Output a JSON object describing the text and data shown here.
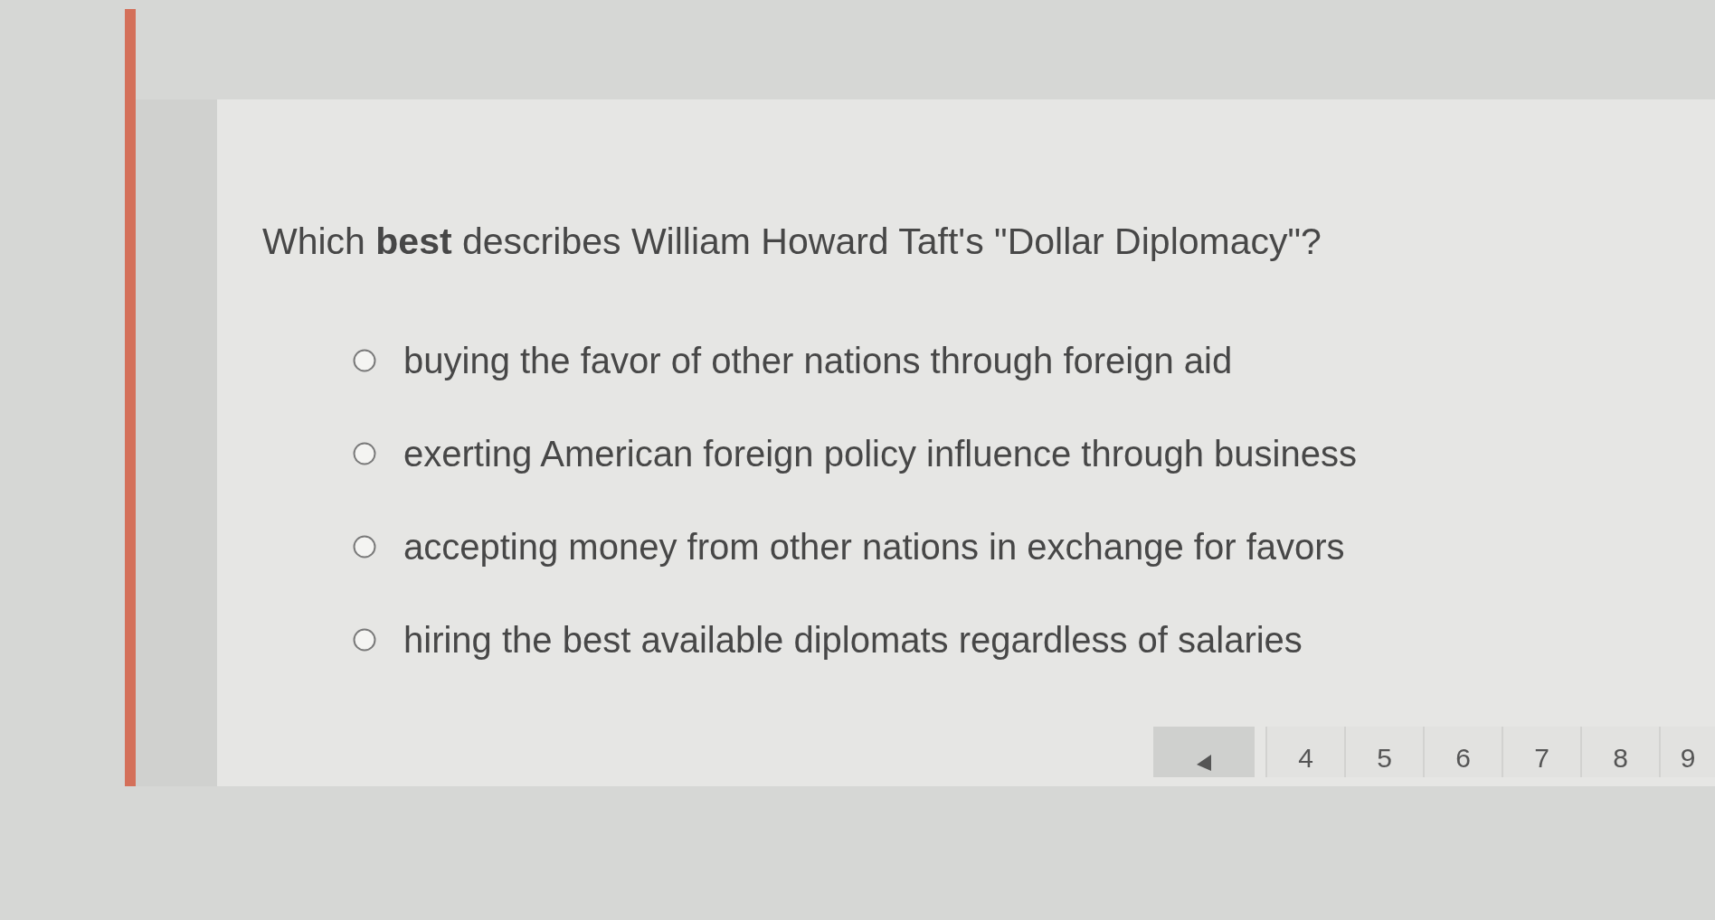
{
  "question": "Which **best** describes William Howard Taft's \"Dollar Diplomacy\"?",
  "options": [
    {
      "label": "buying the favor of other nations through foreign aid",
      "selected": false
    },
    {
      "label": "exerting American foreign policy influence through business",
      "selected": false
    },
    {
      "label": "accepting money from other nations in exchange for favors",
      "selected": false
    },
    {
      "label": "hiring the best available diplomats regardless of salaries",
      "selected": false
    }
  ],
  "pagination": {
    "pages": [
      {
        "label": "4",
        "selected": false
      },
      {
        "label": "5",
        "selected": false
      },
      {
        "label": "6",
        "selected": false
      },
      {
        "label": "7",
        "selected": false
      },
      {
        "label": "8",
        "selected": false
      },
      {
        "label": "9",
        "selected": false
      }
    ]
  }
}
